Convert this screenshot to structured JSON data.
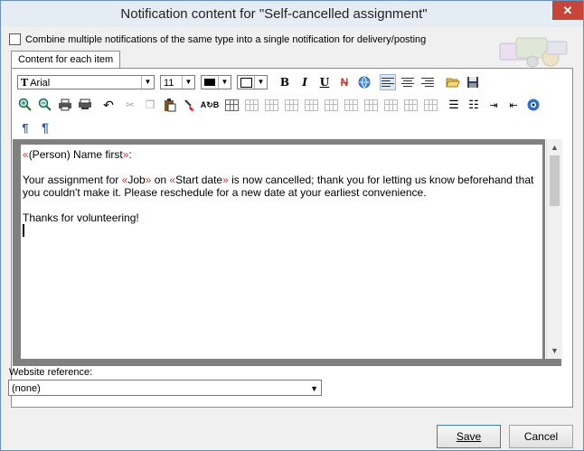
{
  "window": {
    "title": "Notification content for \"Self-cancelled assignment\"",
    "close_glyph": "✕"
  },
  "combine": {
    "label": "Combine multiple notifications of the same type into a single notification for delivery/posting",
    "checked": false
  },
  "tab": {
    "label": "Content for each item"
  },
  "toolbar": {
    "font_name": "Arial",
    "font_size": "11",
    "bold": "B",
    "italic": "I",
    "underline": "U",
    "strike": "N",
    "pilcrow": "¶"
  },
  "editor": {
    "line1_field_open": "«",
    "line1_field": "(Person) Name first",
    "line1_field_close": "»",
    "line1_rest": ":",
    "p2_a": "Your assignment for ",
    "p2_f1_open": "«",
    "p2_f1": "Job",
    "p2_f1_close": "»",
    "p2_b": " on ",
    "p2_f2_open": "«",
    "p2_f2": "Start date",
    "p2_f2_close": "»",
    "p2_c": " is now cancelled; thank you for letting us know beforehand that you couldn't make it. Please reschedule for a new date at your earliest convenience.",
    "p3": "Thanks for volunteering!"
  },
  "website": {
    "label": "Website reference:",
    "value": "(none)"
  },
  "buttons": {
    "save": "Save",
    "cancel": "Cancel"
  },
  "colors": {
    "field_marker": "#c0392b",
    "close_button": "#c7463c",
    "title_bar": "#e6ecf4"
  }
}
